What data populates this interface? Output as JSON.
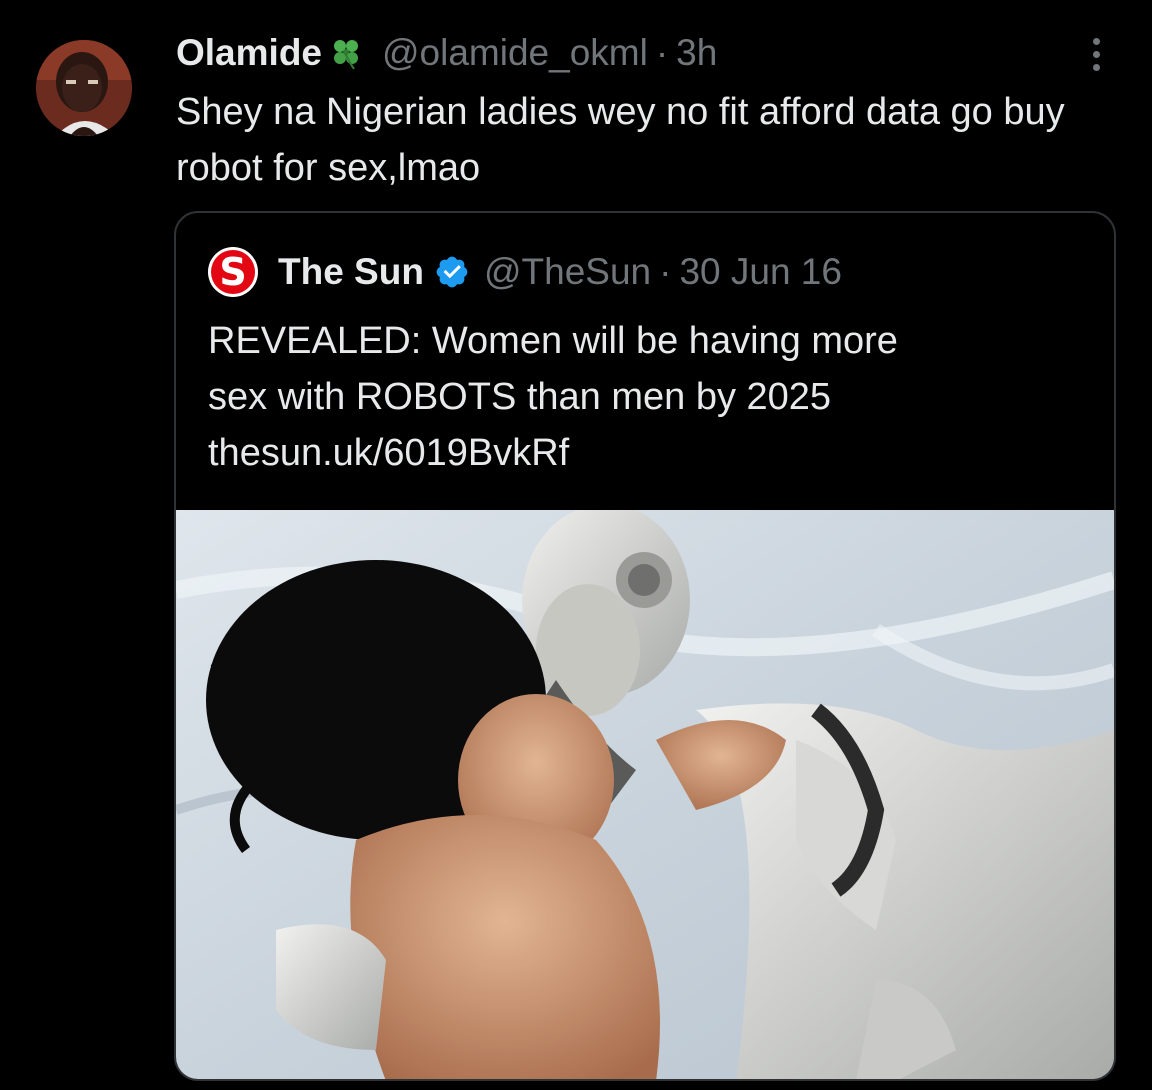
{
  "tweet": {
    "display_name": "Olamide",
    "name_emoji": "four-leaf-clover-icon",
    "handle": "@olamide_okml",
    "separator": "·",
    "time": "3h",
    "text": "Shey na Nigerian ladies wey no fit afford data go buy robot for sex,lmao",
    "more_icon": "more-vertical-icon"
  },
  "quoted_tweet": {
    "account_logo": "S",
    "display_name": "The Sun",
    "verified_icon": "verified-badge-icon",
    "handle": "@TheSun",
    "separator": "·",
    "date": "30 Jun 16",
    "text_lines": [
      "REVEALED: Women will be having more",
      "sex with ROBOTS than men by 2025",
      "thesun.uk/6019BvkRf"
    ],
    "image_alt": "Woman sleeping beside a humanoid robot on white bed sheets"
  },
  "colors": {
    "background": "#000000",
    "text_primary": "#e7e9ea",
    "text_secondary": "#71767b",
    "border": "#2f3336",
    "verified_blue": "#1d9bf0",
    "sun_red": "#e30613"
  }
}
